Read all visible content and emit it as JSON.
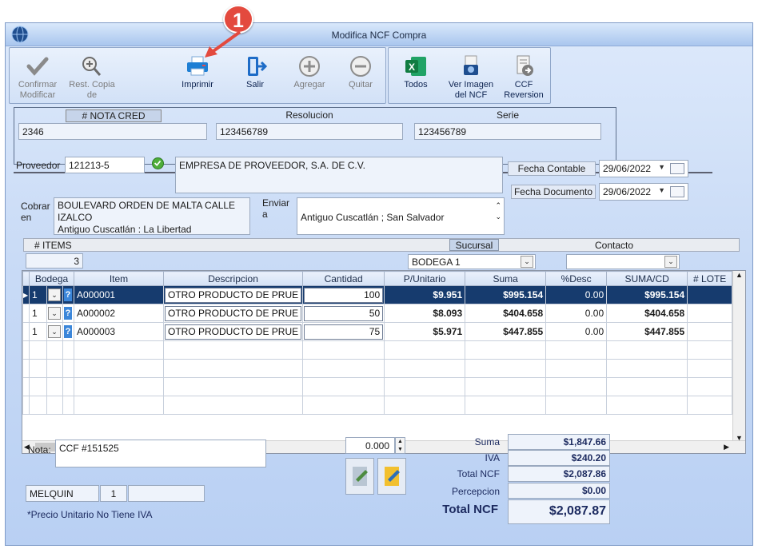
{
  "window": {
    "title": "Modifica NCF Compra"
  },
  "annotation": {
    "badge": "1"
  },
  "toolbar": {
    "confirm": "Confirmar Modificar",
    "rest_copy": "Rest. Copia de",
    "print": "Imprimir",
    "exit": "Salir",
    "add": "Agregar",
    "remove": "Quitar",
    "all": "Todos",
    "view_image": "Ver Imagen del NCF",
    "ccf_reversion": "CCF Reversion"
  },
  "doc": {
    "nota_label": "# NOTA CRED",
    "nota_value": "2346",
    "resolucion_label": "Resolucion",
    "resolucion_value": "123456789",
    "serie_label": "Serie",
    "serie_value": "123456789"
  },
  "proveedor": {
    "label": "Proveedor",
    "code": "121213-5",
    "name": "EMPRESA DE PROVEEDOR, S.A. DE C.V."
  },
  "fechas": {
    "contable_label": "Fecha Contable",
    "contable_value": "29/06/2022",
    "documento_label": "Fecha Documento",
    "documento_value": "29/06/2022"
  },
  "cobrar": {
    "label": "Cobrar en",
    "value_line1": "BOULEVARD ORDEN DE MALTA CALLE",
    "value_line2": "IZALCO",
    "value_line3": "Antiguo Cuscatlán : La Libertad"
  },
  "enviar": {
    "label": "Enviar a",
    "value": "Antiguo Cuscatlán ; San Salvador"
  },
  "items_bar": {
    "items_label": "# ITEMS",
    "items_count": "3",
    "sucursal_label": "Sucursal",
    "sucursal_value": "BODEGA 1",
    "contacto_label": "Contacto",
    "contacto_value": ""
  },
  "grid": {
    "headers": [
      "Bodega",
      "Item",
      "Descripcion",
      "Cantidad",
      "P/Unitario",
      "Suma",
      "%Desc",
      "SUMA/CD",
      "# LOTE"
    ],
    "rows": [
      {
        "bodega": "1",
        "item": "A000001",
        "desc": "OTRO PRODUCTO DE PRUE",
        "cantidad": "100",
        "punit": "$9.951",
        "suma": "$995.154",
        "desc_pct": "0.00",
        "sumacd": "$995.154",
        "lote": ""
      },
      {
        "bodega": "1",
        "item": "A000002",
        "desc": "OTRO PRODUCTO DE PRUE",
        "cantidad": "50",
        "punit": "$8.093",
        "suma": "$404.658",
        "desc_pct": "0.00",
        "sumacd": "$404.658",
        "lote": ""
      },
      {
        "bodega": "1",
        "item": "A000003",
        "desc": "OTRO PRODUCTO DE PRUE",
        "cantidad": "75",
        "punit": "$5.971",
        "suma": "$447.855",
        "desc_pct": "0.00",
        "sumacd": "$447.855",
        "lote": ""
      }
    ]
  },
  "nota": {
    "label": "Nota:",
    "value": "CCF  #151525"
  },
  "spinner": {
    "value": "0.000"
  },
  "user": {
    "name": "MELQUIN",
    "num": "1",
    "extra": ""
  },
  "footer_note": "*Precio Unitario No Tiene IVA",
  "totals": {
    "suma_label": "Suma",
    "suma": "$1,847.66",
    "iva_label": "IVA",
    "iva": "$240.20",
    "total_ncf_label": "Total  NCF",
    "total_ncf": "$2,087.86",
    "percepcion_label": "Percepcion",
    "percepcion": "$0.00",
    "grand_label": "Total  NCF",
    "grand": "$2,087.87"
  }
}
